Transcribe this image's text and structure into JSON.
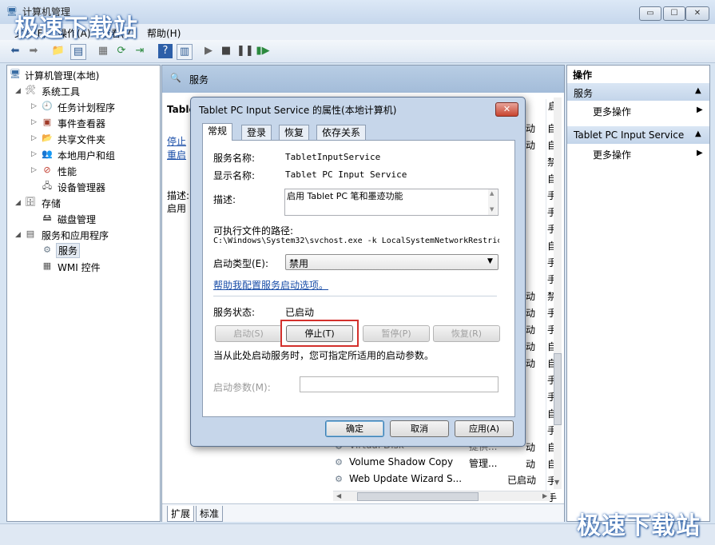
{
  "window": {
    "title": "计算机管理"
  },
  "window_controls": {
    "minimize": "▭",
    "maximize": "☐",
    "close": "✕"
  },
  "menu": [
    "文件(F)",
    "操作(A)",
    "查看(V)",
    "帮助(H)"
  ],
  "tree": {
    "root": "计算机管理(本地)",
    "system_tools": "系统工具",
    "task_scheduler": "任务计划程序",
    "event_viewer": "事件查看器",
    "shared_folders": "共享文件夹",
    "local_users": "本地用户和组",
    "performance": "性能",
    "device_manager": "设备管理器",
    "storage": "存储",
    "disk_management": "磁盘管理",
    "services_apps": "服务和应用程序",
    "services": "服务",
    "wmi": "WMI 控件"
  },
  "center": {
    "header": "服务",
    "service_title": "Tablet",
    "link1": "停止",
    "link2": "重启",
    "desc_label": "描述:",
    "desc_value": "启用",
    "tabs": [
      "扩展",
      "标准"
    ],
    "list": [
      {
        "name": "Virtual Disk",
        "desc": "提供...",
        "status": ""
      },
      {
        "name": "Volume Shadow Copy",
        "desc": "管理...",
        "status": ""
      },
      {
        "name": "Web Update Wizard S...",
        "desc": "",
        "status": "已启动"
      }
    ],
    "right_col_status": [
      "动",
      "动",
      "",
      "",
      "",
      "",
      "",
      "",
      "",
      "",
      "动",
      "动",
      "动",
      "动",
      "动",
      "",
      "",
      "",
      "",
      "动",
      "动"
    ],
    "right_col_type": [
      "自",
      "自",
      "禁",
      "自",
      "手",
      "手",
      "手",
      "自",
      "手",
      "手",
      "禁",
      "手",
      "手",
      "自",
      "自",
      "手",
      "手",
      "自",
      "手",
      "自",
      "自",
      "手",
      "手",
      "手"
    ]
  },
  "actions": {
    "header": "操作",
    "section1": "服务",
    "section1_more": "更多操作",
    "section2": "Tablet PC Input Service",
    "section2_more": "更多操作"
  },
  "dialog": {
    "title": "Tablet PC Input Service 的属性(本地计算机)",
    "tabs": [
      "常规",
      "登录",
      "恢复",
      "依存关系"
    ],
    "service_name_label": "服务名称:",
    "service_name": "TabletInputService",
    "display_name_label": "显示名称:",
    "display_name": "Tablet PC Input Service",
    "description_label": "描述:",
    "description": "启用 Tablet PC 笔和墨迹功能",
    "path_label": "可执行文件的路径:",
    "path": "C:\\Windows\\System32\\svchost.exe -k LocalSystemNetworkRestric",
    "startup_type_label": "启动类型(E):",
    "startup_type": "禁用",
    "help_link": "帮助我配置服务启动选项。",
    "status_label": "服务状态:",
    "status_value": "已启动",
    "btn_start": "启动(S)",
    "btn_stop": "停止(T)",
    "btn_pause": "暂停(P)",
    "btn_resume": "恢复(R)",
    "hint": "当从此处启动服务时，您可指定所适用的启动参数。",
    "params_label": "启动参数(M):",
    "params_value": "",
    "ok": "确定",
    "cancel": "取消",
    "apply": "应用(A)"
  },
  "watermark": "极速下载站",
  "colors": {
    "highlight": "#d3302c",
    "link": "#1a4ea8",
    "action_bg": "#c3d5ea"
  }
}
